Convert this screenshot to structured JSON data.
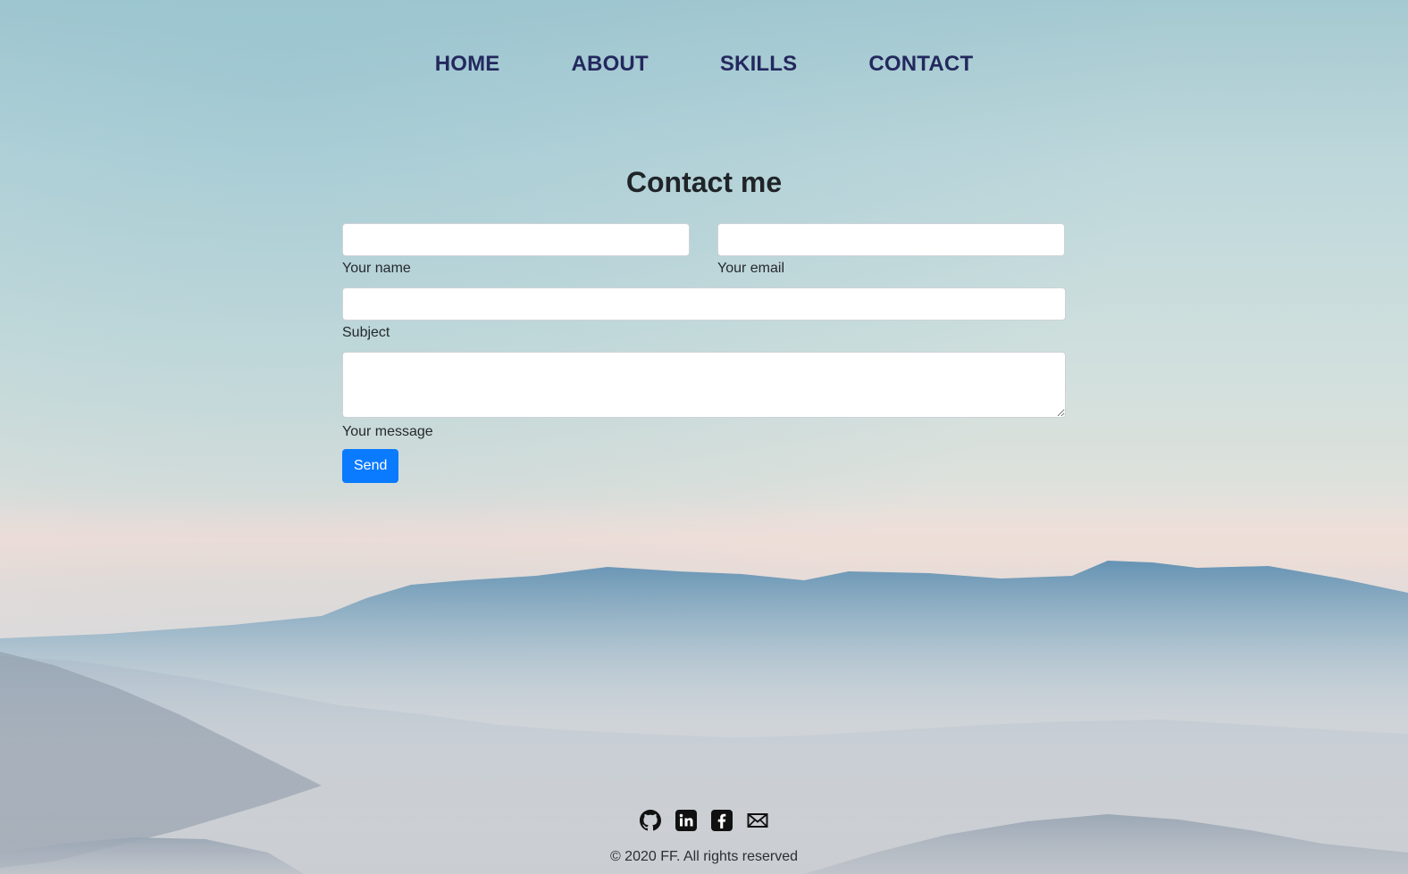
{
  "nav": {
    "items": [
      {
        "label": "HOME"
      },
      {
        "label": "ABOUT"
      },
      {
        "label": "SKILLS"
      },
      {
        "label": "CONTACT"
      }
    ]
  },
  "contact": {
    "title": "Contact me",
    "fields": {
      "name_label": "Your name",
      "name_value": "",
      "email_label": "Your email",
      "email_value": "",
      "subject_label": "Subject",
      "subject_value": "",
      "message_label": "Your message",
      "message_value": ""
    },
    "send_label": "Send"
  },
  "footer": {
    "social_icons": [
      "github-icon",
      "linkedin-icon",
      "facebook-icon",
      "mail-icon"
    ],
    "copyright": "© 2020 FF. All rights reserved"
  },
  "colors": {
    "nav_text": "#23285e",
    "button": "#0a7bff",
    "mountain_far": "#5f8fb0"
  }
}
